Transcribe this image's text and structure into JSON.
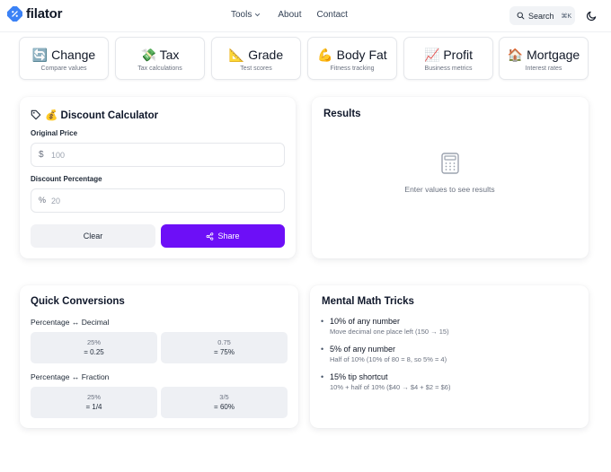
{
  "brand": {
    "name": "filator",
    "accent": "#3b82f6"
  },
  "nav": {
    "tools": "Tools",
    "about": "About",
    "contact": "Contact"
  },
  "search": {
    "label": "Search",
    "shortcut": "⌘K"
  },
  "categories": [
    {
      "emoji": "🔄",
      "title": "Change",
      "subtitle": "Compare values"
    },
    {
      "emoji": "💸",
      "title": "Tax",
      "subtitle": "Tax calculations"
    },
    {
      "emoji": "📐",
      "title": "Grade",
      "subtitle": "Test scores"
    },
    {
      "emoji": "💪",
      "title": "Body Fat",
      "subtitle": "Fitness tracking"
    },
    {
      "emoji": "📈",
      "title": "Profit",
      "subtitle": "Business metrics"
    },
    {
      "emoji": "🏠",
      "title": "Mortgage",
      "subtitle": "Interest rates"
    }
  ],
  "calculator": {
    "title": "💰 Discount Calculator",
    "original_price": {
      "label": "Original Price",
      "placeholder": "100",
      "value": ""
    },
    "discount": {
      "label": "Discount Percentage",
      "placeholder": "20",
      "value": ""
    },
    "clear_label": "Clear",
    "share_label": "Share",
    "share_color": "#6d0ff7"
  },
  "results": {
    "title": "Results",
    "empty_text": "Enter values to see results"
  },
  "conversions": {
    "title": "Quick Conversions",
    "groups": [
      {
        "title": "Percentage ↔ Decimal",
        "items": [
          {
            "a": "25%",
            "b": "= 0.25"
          },
          {
            "a": "0.75",
            "b": "= 75%"
          }
        ]
      },
      {
        "title": "Percentage ↔ Fraction",
        "items": [
          {
            "a": "25%",
            "b": "= 1/4"
          },
          {
            "a": "3/5",
            "b": "= 60%"
          }
        ]
      }
    ]
  },
  "tricks": {
    "title": "Mental Math Tricks",
    "items": [
      {
        "title": "10% of any number",
        "desc": "Move decimal one place left (150 → 15)"
      },
      {
        "title": "5% of any number",
        "desc": "Half of 10% (10% of 80 = 8, so 5% = 4)"
      },
      {
        "title": "15% tip shortcut",
        "desc": "10% + half of 10% ($40 → $4 + $2 = $6)"
      }
    ]
  }
}
